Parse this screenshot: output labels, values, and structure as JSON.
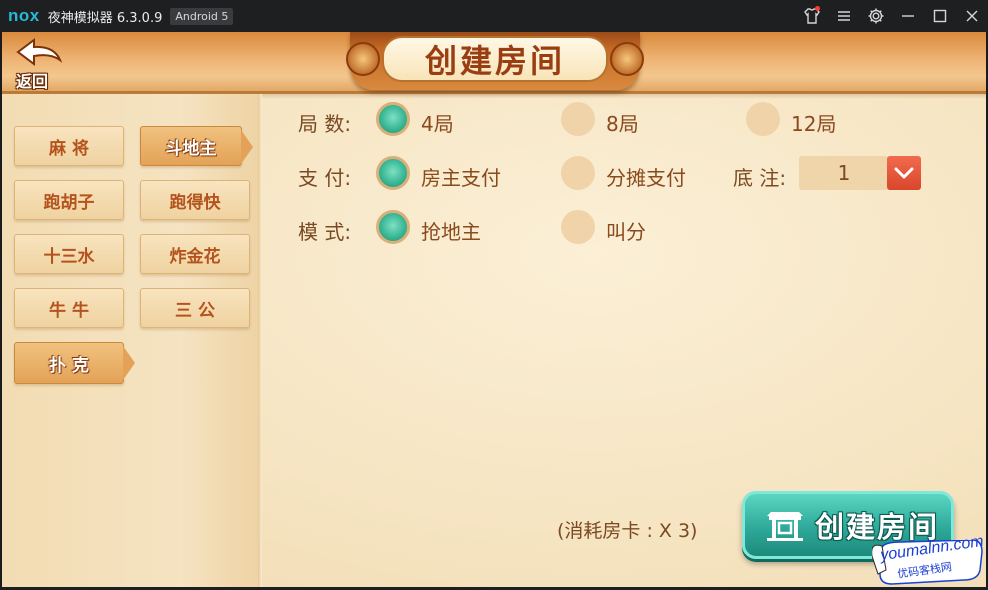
{
  "titlebar": {
    "logo": "nox",
    "title": "夜神模拟器 6.3.0.9",
    "android_badge": "Android 5",
    "icons": [
      "shirt-icon",
      "menu-icon",
      "gear-icon",
      "minimize-icon",
      "maximize-icon",
      "close-icon"
    ]
  },
  "header": {
    "back_label": "返回",
    "title": "创建房间"
  },
  "categories_left": [
    {
      "label": "麻 将"
    },
    {
      "label": "跑胡子"
    },
    {
      "label": "十三水"
    },
    {
      "label": "牛 牛"
    },
    {
      "label": "扑 克",
      "active": true
    }
  ],
  "categories_right": [
    {
      "label": "斗地主",
      "active": true
    },
    {
      "label": "跑得快"
    },
    {
      "label": "炸金花"
    },
    {
      "label": "三 公"
    }
  ],
  "options": {
    "rounds": {
      "label": "局 数:",
      "choices": [
        "4局",
        "8局",
        "12局"
      ],
      "selected": "4局"
    },
    "payment": {
      "label": "支 付:",
      "choices": [
        "房主支付",
        "分摊支付"
      ],
      "selected": "房主支付"
    },
    "mode": {
      "label": "模 式:",
      "choices": [
        "抢地主",
        "叫分"
      ],
      "selected": "抢地主"
    },
    "base_bet": {
      "label": "底 注:",
      "value": "1"
    }
  },
  "footer": {
    "cost_text": "(消耗房卡 : X 3)",
    "create_button": "创建房间"
  },
  "watermark": {
    "line1": "youmalnn.com",
    "line2": "优码客栈网"
  },
  "colors": {
    "accent_teal": "#2ea99a",
    "header_orange": "#e2a866",
    "dropdown_red": "#d9462c",
    "text_brown": "#8a4a1e"
  }
}
